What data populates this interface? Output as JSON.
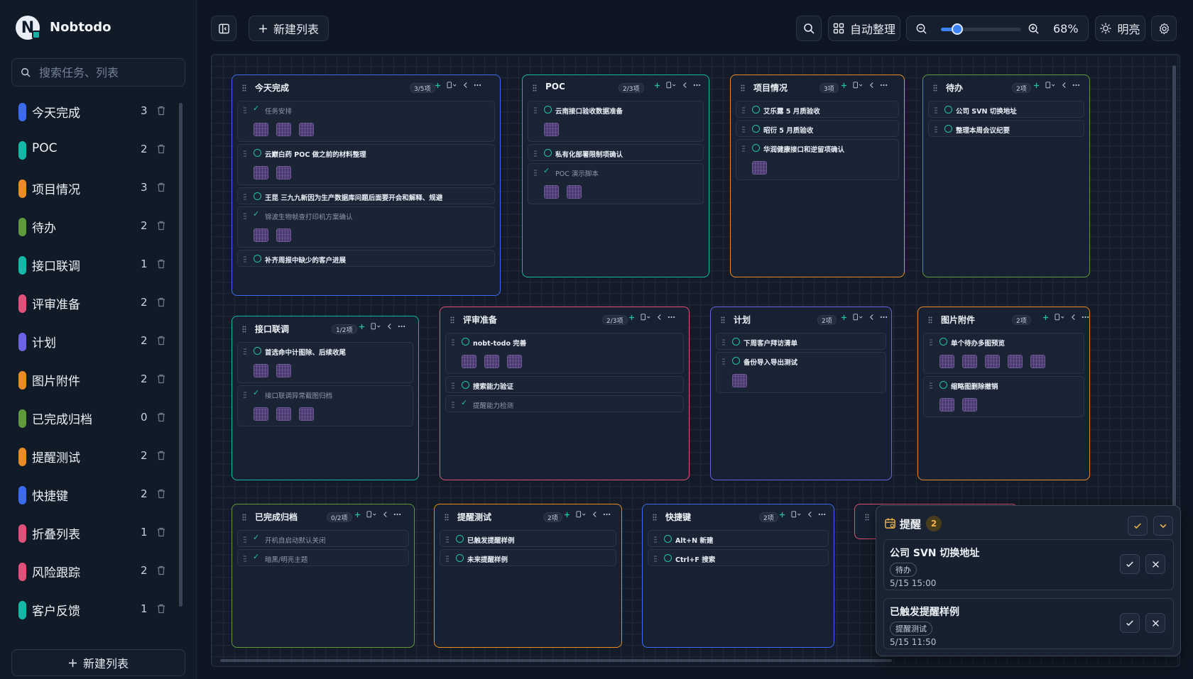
{
  "app": {
    "name": "Nobtodo"
  },
  "search": {
    "placeholder": "搜索任务、列表"
  },
  "sidebar": {
    "items": [
      {
        "label": "今天完成",
        "count": "3",
        "color": "#3b6cf0"
      },
      {
        "label": "POC",
        "count": "2",
        "color": "#14b8a6"
      },
      {
        "label": "项目情况",
        "count": "3",
        "color": "#ea8c24"
      },
      {
        "label": "待办",
        "count": "2",
        "color": "#5f9b3b"
      },
      {
        "label": "接口联调",
        "count": "1",
        "color": "#14b8a6"
      },
      {
        "label": "评审准备",
        "count": "2",
        "color": "#e0517a"
      },
      {
        "label": "计划",
        "count": "2",
        "color": "#6b63e6"
      },
      {
        "label": "图片附件",
        "count": "2",
        "color": "#ea8c24"
      },
      {
        "label": "已完成归档",
        "count": "0",
        "color": "#5f9b3b"
      },
      {
        "label": "提醒测试",
        "count": "2",
        "color": "#ea8c24"
      },
      {
        "label": "快捷键",
        "count": "2",
        "color": "#3b6cf0"
      },
      {
        "label": "折叠列表",
        "count": "1",
        "color": "#e0517a"
      },
      {
        "label": "风险跟踪",
        "count": "2",
        "color": "#e0517a"
      },
      {
        "label": "客户反馈",
        "count": "1",
        "color": "#14b8a6"
      }
    ],
    "new_list_label": "新建列表"
  },
  "toolbar": {
    "new_list_label": "新建列表",
    "auto_arrange_label": "自动整理",
    "zoom_text": "68%",
    "zoom_level": 0.2,
    "theme_label": "明亮"
  },
  "lists": [
    {
      "title": "今天完成",
      "badge": "3/5项",
      "color": "#3b6cf0",
      "tasks": [
        {
          "text": "任务安排",
          "done": true,
          "images": 3
        },
        {
          "text": "云巅白药 POC 做之前的材料整理",
          "done": false,
          "images": 2
        },
        {
          "text": "王昆 三九九新因为生产数据库问题后面要开会和解释、规避",
          "done": false,
          "images": 0
        },
        {
          "text": "锦波生物帧查打印机方案确认",
          "done": true,
          "images": 2
        },
        {
          "text": "补齐周报中缺少的客户进展",
          "done": false,
          "images": 0
        }
      ]
    },
    {
      "title": "POC",
      "badge": "2/3项",
      "color": "#14b8a6",
      "tasks": [
        {
          "text": "云南接口验收数据准备",
          "done": false,
          "images": 1
        },
        {
          "text": "私有化部署限制项确认",
          "done": false,
          "images": 0
        },
        {
          "text": "POC 演示脚本",
          "done": true,
          "images": 2
        }
      ]
    },
    {
      "title": "项目情况",
      "badge": "3项",
      "color": "#ea8c24",
      "tasks": [
        {
          "text": "艾乐露 5 月质验收",
          "done": false,
          "images": 0
        },
        {
          "text": "昭衍 5 月质验收",
          "done": false,
          "images": 0
        },
        {
          "text": "华润健康接口和逆留项确认",
          "done": false,
          "images": 1
        }
      ]
    },
    {
      "title": "待办",
      "badge": "2项",
      "color": "#5f9b3b",
      "tasks": [
        {
          "text": "公司 SVN 切换地址",
          "done": false,
          "images": 0
        },
        {
          "text": "整理本周会议纪要",
          "done": false,
          "images": 0
        }
      ]
    },
    {
      "title": "接口联调",
      "badge": "1/2项",
      "color": "#14b8a6",
      "tasks": [
        {
          "text": "首选命中计图除、后续收尾",
          "done": false,
          "images": 2
        },
        {
          "text": "接口联调异常截图归档",
          "done": true,
          "images": 3
        }
      ]
    },
    {
      "title": "评审准备",
      "badge": "2/3项",
      "color": "#e0517a",
      "tasks": [
        {
          "text": "nobt-todo 完善",
          "done": false,
          "images": 3
        },
        {
          "text": "搜索能力验证",
          "done": false,
          "images": 0
        },
        {
          "text": "提醒能力检测",
          "done": true,
          "images": 0
        }
      ]
    },
    {
      "title": "计划",
      "badge": "2项",
      "color": "#6b63e6",
      "tasks": [
        {
          "text": "下周客户拜访清单",
          "done": false,
          "images": 0
        },
        {
          "text": "备份导入导出测试",
          "done": false,
          "images": 1
        }
      ]
    },
    {
      "title": "图片附件",
      "badge": "2项",
      "color": "#ea8c24",
      "tasks": [
        {
          "text": "单个待办多图预览",
          "done": false,
          "images": 5
        },
        {
          "text": "缩略图删除撤销",
          "done": false,
          "images": 2
        }
      ]
    },
    {
      "title": "已完成归档",
      "badge": "0/2项",
      "color": "#5f9b3b",
      "tasks": [
        {
          "text": "开机自启动默认关闭",
          "done": true,
          "images": 0
        },
        {
          "text": "暗黑/明亮主题",
          "done": true,
          "images": 0
        }
      ]
    },
    {
      "title": "提醒测试",
      "badge": "2项",
      "color": "#ea8c24",
      "tasks": [
        {
          "text": "已触发提醒样例",
          "done": false,
          "images": 0
        },
        {
          "text": "未来提醒样例",
          "done": false,
          "images": 0
        }
      ]
    },
    {
      "title": "快捷键",
      "badge": "2项",
      "color": "#3b6cf0",
      "tasks": [
        {
          "text": "Alt+N 新建",
          "done": false,
          "images": 0
        },
        {
          "text": "Ctrl+F 搜索",
          "done": false,
          "images": 0
        }
      ]
    },
    {
      "title": "",
      "badge": "",
      "color": "#e0517a",
      "tasks": []
    }
  ],
  "reminder": {
    "title": "提醒",
    "count": "2",
    "items": [
      {
        "title": "公司 SVN 切换地址",
        "tag": "待办",
        "time": "5/15 15:00"
      },
      {
        "title": "已触发提醒样例",
        "tag": "提醒测试",
        "time": "5/15 11:50"
      }
    ]
  },
  "icons": {
    "search": "search-icon",
    "sidebar_toggle": "sidebar-toggle-icon",
    "plus": "plus-icon",
    "grid": "grid-icon",
    "zoom_out": "zoom-out-icon",
    "zoom_in": "zoom-in-icon",
    "sun": "sun-icon",
    "gear": "gear-icon",
    "calendar": "calendar-icon",
    "check": "check-icon",
    "close": "close-icon",
    "chevron_down": "chevron-down-icon"
  }
}
